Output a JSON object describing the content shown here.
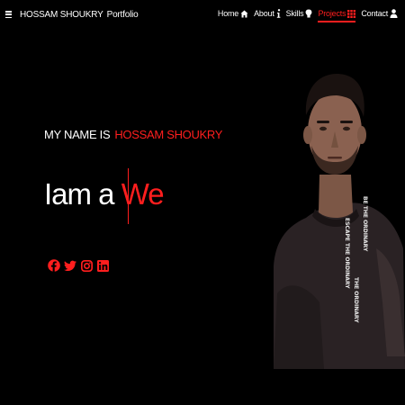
{
  "brand": {
    "first": "HOSSAM SHOUKRY",
    "second": "Portfolio"
  },
  "nav": {
    "items": [
      {
        "label": "Home",
        "icon": "home-icon"
      },
      {
        "label": "About",
        "icon": "info-icon"
      },
      {
        "label": "Skills",
        "icon": "brain-icon"
      },
      {
        "label": "Projects",
        "icon": "grid-icon",
        "active": true
      },
      {
        "label": "Contact",
        "icon": "user-icon"
      }
    ]
  },
  "hero": {
    "intro_prefix": "MY NAME IS",
    "intro_name": "HOSSAM SHOUKRY",
    "typed_prefix": "Iam a",
    "typed_word": "We"
  },
  "socials": [
    "facebook-icon",
    "twitter-icon",
    "instagram-icon",
    "linkedin-icon"
  ],
  "photo": {
    "shirt_text": [
      "BE THE ORDINARY",
      "ESCAPE THE ORDINARY",
      "THE ORDINARY"
    ]
  },
  "colors": {
    "accent": "#ff1e1e",
    "background": "#000000",
    "text": "#ffffff"
  }
}
